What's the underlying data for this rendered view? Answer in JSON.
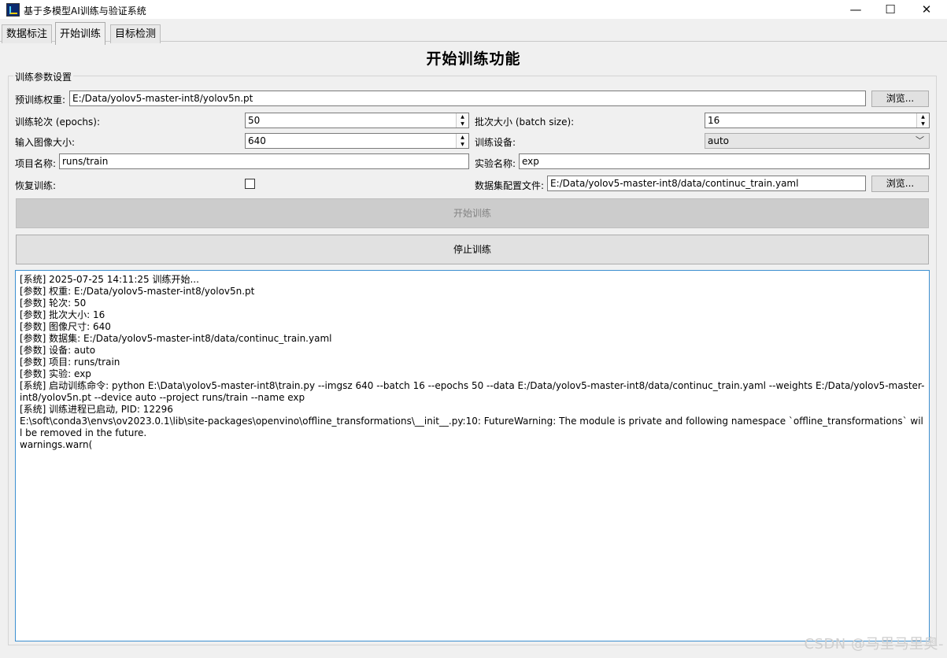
{
  "window": {
    "title": "基于多模型AI训练与验证系统",
    "controls": [
      "—",
      "☐",
      "✕"
    ]
  },
  "tabs": [
    {
      "label": "数据标注",
      "active": false
    },
    {
      "label": "开始训练",
      "active": true
    },
    {
      "label": "目标检测",
      "active": false
    }
  ],
  "page": {
    "title": "开始训练功能"
  },
  "params": {
    "group_title": "训练参数设置",
    "weights_label": "预训练权重:",
    "weights_value": "E:/Data/yolov5-master-int8/yolov5n.pt",
    "browse_label": "浏览...",
    "epochs_label": "训练轮次 (epochs):",
    "epochs_value": "50",
    "batch_label": "批次大小 (batch size):",
    "batch_value": "16",
    "imgsz_label": "输入图像大小:",
    "imgsz_value": "640",
    "device_label": "训练设备:",
    "device_value": "auto",
    "project_label": "项目名称:",
    "project_value": "runs/train",
    "name_label": "实验名称:",
    "name_value": "exp",
    "resume_label": "恢复训练:",
    "resume_checked": false,
    "dataset_label": "数据集配置文件:",
    "dataset_value": "E:/Data/yolov5-master-int8/data/continuc_train.yaml",
    "browse2_label": "浏览..."
  },
  "actions": {
    "start_label": "开始训练",
    "stop_label": "停止训练"
  },
  "log": {
    "lines": [
      "[系统] 2025-07-25 14:11:25 训练开始...",
      "[参数] 权重: E:/Data/yolov5-master-int8/yolov5n.pt",
      "[参数] 轮次: 50",
      "[参数] 批次大小: 16",
      "[参数] 图像尺寸: 640",
      "[参数] 数据集: E:/Data/yolov5-master-int8/data/continuc_train.yaml",
      "[参数] 设备: auto",
      "[参数] 项目: runs/train",
      "[参数] 实验: exp",
      "[系统] 启动训练命令: python E:\\Data\\yolov5-master-int8\\train.py --imgsz 640 --batch 16 --epochs 50 --data E:/Data/yolov5-master-int8/data/continuc_train.yaml --weights E:/Data/yolov5-master-int8/yolov5n.pt --device auto --project runs/train --name exp",
      "[系统] 训练进程已启动, PID: 12296",
      "E:\\soft\\conda3\\envs\\ov2023.0.1\\lib\\site-packages\\openvino\\offline_transformations\\__init__.py:10: FutureWarning: The module is private and following namespace `offline_transformations` will be removed in the future.",
      "warnings.warn("
    ]
  },
  "watermark": "CSDN @马里马里奥-"
}
